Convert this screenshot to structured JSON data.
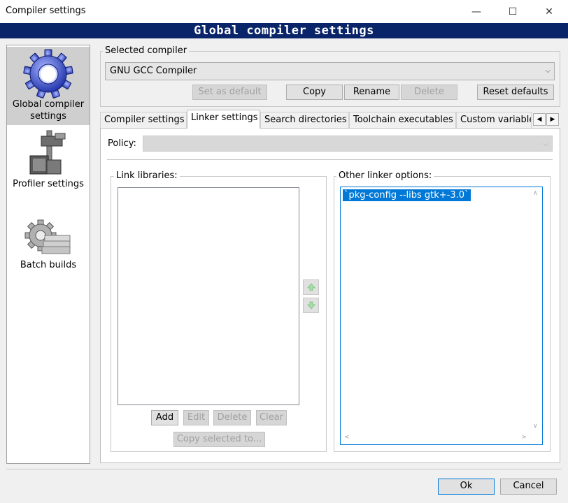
{
  "window": {
    "title": "Compiler settings",
    "minimize": "—",
    "maximize": "☐",
    "close": "✕"
  },
  "banner": {
    "title": "Global compiler settings"
  },
  "sidebar": {
    "items": [
      {
        "label": "Global compiler settings",
        "icon": "gear-icon",
        "selected": true
      },
      {
        "label": "Profiler settings",
        "icon": "caliper-icon",
        "selected": false
      },
      {
        "label": "Batch builds",
        "icon": "gear-stack-icon",
        "selected": false
      }
    ]
  },
  "compiler": {
    "group_label": "Selected compiler",
    "selected": "GNU GCC Compiler",
    "buttons": {
      "set_default": "Set as default",
      "copy": "Copy",
      "rename": "Rename",
      "delete": "Delete",
      "reset": "Reset defaults"
    }
  },
  "tabs": [
    {
      "label": "Compiler settings",
      "active": false
    },
    {
      "label": "Linker settings",
      "active": true
    },
    {
      "label": "Search directories",
      "active": false
    },
    {
      "label": "Toolchain executables",
      "active": false
    },
    {
      "label": "Custom variable",
      "active": false
    }
  ],
  "tab_scroll": {
    "left": "◀",
    "right": "▶"
  },
  "linker": {
    "policy_label": "Policy:",
    "policy_value": "",
    "link_libraries_label": "Link libraries:",
    "link_libraries": [],
    "other_options_label": "Other linker options:",
    "other_options_text": "`pkg-config --libs gtk+-3.0`",
    "buttons": {
      "add": "Add",
      "edit": "Edit",
      "delete": "Delete",
      "clear": "Clear",
      "copy_selected": "Copy selected to..."
    }
  },
  "footer": {
    "ok": "Ok",
    "cancel": "Cancel"
  },
  "colors": {
    "banner": "#0a246a",
    "selection": "#0078d7",
    "accent_border": "#0078d7"
  }
}
